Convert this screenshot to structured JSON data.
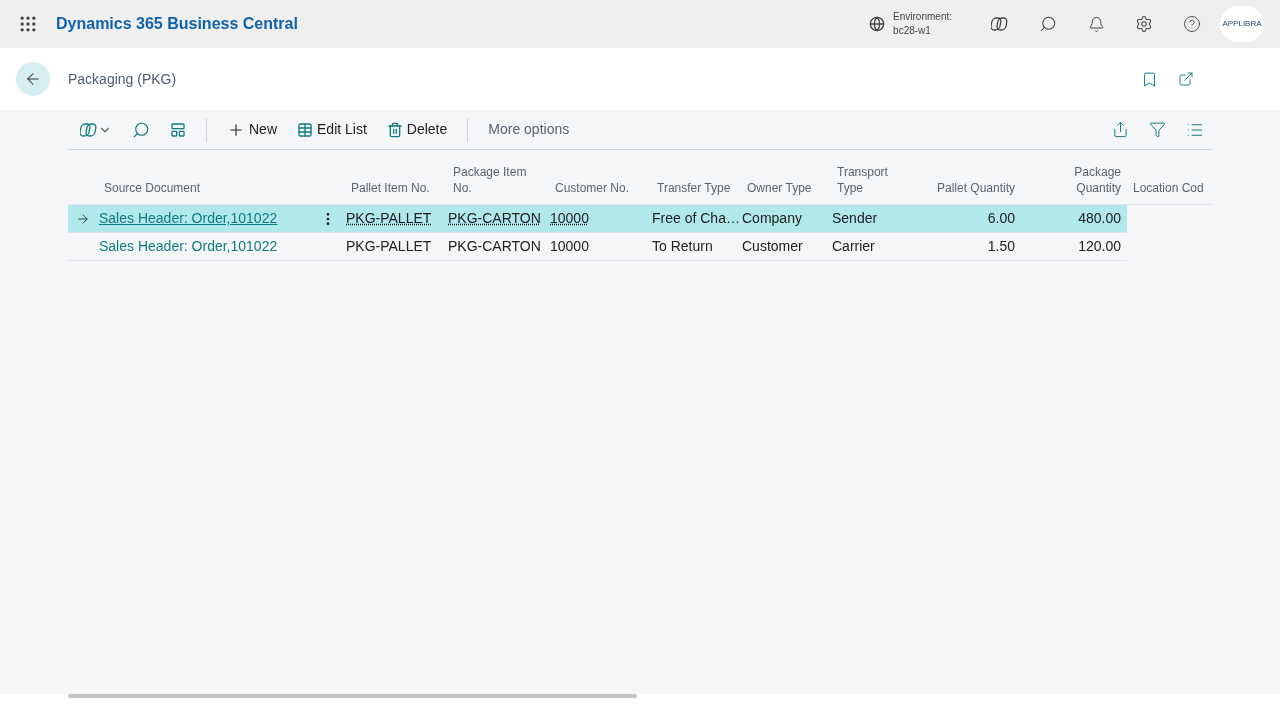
{
  "app_bar": {
    "title": "Dynamics 365 Business Central",
    "environment_label": "Environment:",
    "environment_value": "bc28-w1",
    "avatar_label": "APPLIBRA"
  },
  "page": {
    "title": "Packaging (PKG)"
  },
  "toolbar": {
    "actions": [
      {
        "label": "New",
        "kind": "new"
      },
      {
        "label": "Edit List",
        "kind": "edit"
      },
      {
        "label": "Delete",
        "kind": "delete"
      }
    ],
    "more": "More options"
  },
  "table": {
    "columns": [
      {
        "label": "Source Document",
        "kind": "text"
      },
      {
        "label": "Pallet Item No.",
        "kind": "text"
      },
      {
        "label": "Package Item No.",
        "kind": "text"
      },
      {
        "label": "Customer No.",
        "kind": "text"
      },
      {
        "label": "Transfer Type",
        "kind": "text"
      },
      {
        "label": "Owner Type",
        "kind": "text"
      },
      {
        "label": "Transport Type",
        "kind": "text"
      },
      {
        "label": "Pallet Quantity",
        "kind": "number"
      },
      {
        "label": "Package Quantity",
        "kind": "number"
      },
      {
        "label": "Location Cod",
        "kind": "text"
      }
    ],
    "rows": [
      {
        "selected": true,
        "cells": [
          "Sales Header: Order,101022",
          "PKG-PALLET",
          "PKG-CARTON",
          "10000",
          "Free of Cha…",
          "Company",
          "Sender",
          "6.00",
          "480.00"
        ]
      },
      {
        "selected": false,
        "cells": [
          "Sales Header: Order,101022",
          "PKG-PALLET",
          "PKG-CARTON",
          "10000",
          "To Return",
          "Customer",
          "Carrier",
          "1.50",
          "120.00"
        ]
      }
    ]
  }
}
